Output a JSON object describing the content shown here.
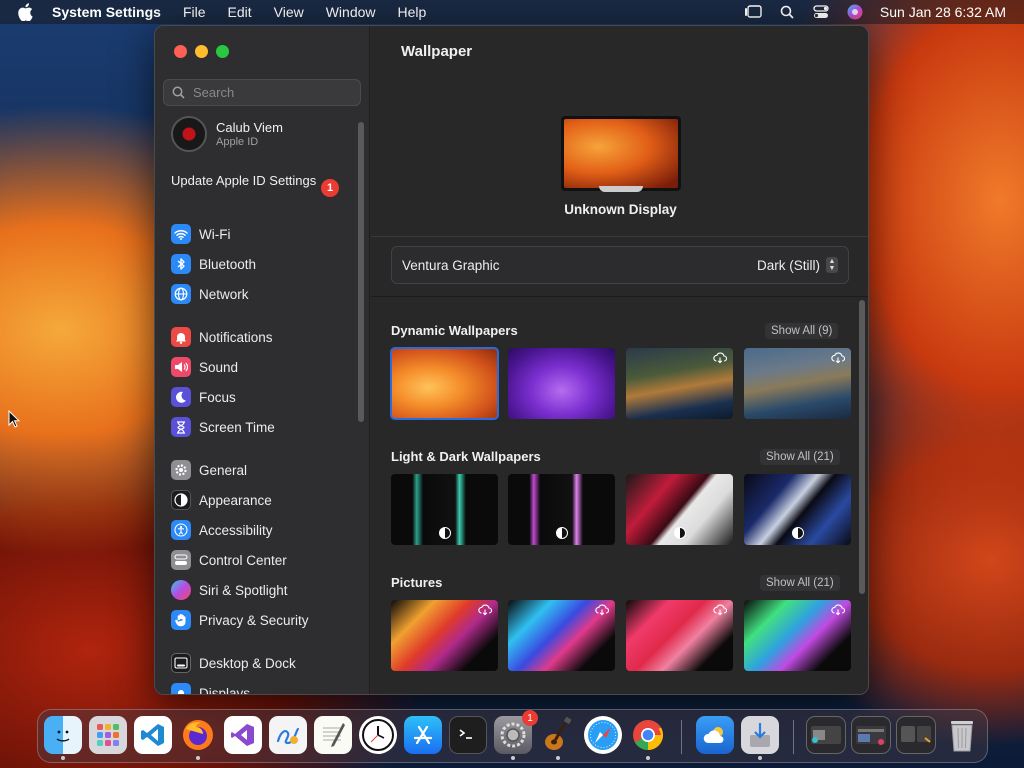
{
  "menubar": {
    "app_name": "System Settings",
    "menus": [
      "File",
      "Edit",
      "View",
      "Window",
      "Help"
    ],
    "datetime": "Sun Jan 28  6:32 AM"
  },
  "sidebar": {
    "search_placeholder": "Search",
    "profile": {
      "name": "Calub Viem",
      "subtitle": "Apple ID"
    },
    "update": {
      "label": "Update Apple ID Settings",
      "badge": "1"
    },
    "items": [
      {
        "label": "Wi-Fi",
        "icon": "wifi-icon",
        "color": "#2b8af7"
      },
      {
        "label": "Bluetooth",
        "icon": "bluetooth-icon",
        "color": "#2b8af7"
      },
      {
        "label": "Network",
        "icon": "globe-icon",
        "color": "#2b8af7"
      },
      {
        "label": "Notifications",
        "icon": "bell-icon",
        "color": "#ec4a45"
      },
      {
        "label": "Sound",
        "icon": "speaker-icon",
        "color": "#ec4a68"
      },
      {
        "label": "Focus",
        "icon": "moon-icon",
        "color": "#5b51d9"
      },
      {
        "label": "Screen Time",
        "icon": "hourglass-icon",
        "color": "#5b51d9"
      },
      {
        "label": "General",
        "icon": "gear-icon",
        "color": "#8e8e93"
      },
      {
        "label": "Appearance",
        "icon": "appearance-icon",
        "color": "#1c1c1e"
      },
      {
        "label": "Accessibility",
        "icon": "accessibility-icon",
        "color": "#2b8af7"
      },
      {
        "label": "Control Center",
        "icon": "control-center-icon",
        "color": "#8e8e93"
      },
      {
        "label": "Siri & Spotlight",
        "icon": "siri-icon",
        "color": "#c2428a"
      },
      {
        "label": "Privacy & Security",
        "icon": "hand-icon",
        "color": "#2b8af7"
      },
      {
        "label": "Desktop & Dock",
        "icon": "dock-icon",
        "color": "#1c1c1e"
      },
      {
        "label": "Displays",
        "icon": "display-icon",
        "color": "#2b8af7"
      }
    ]
  },
  "main": {
    "title": "Wallpaper",
    "display_name": "Unknown Display",
    "wallpaper_name": "Ventura Graphic",
    "wallpaper_mode": "Dark (Still)",
    "sections": [
      {
        "title": "Dynamic Wallpapers",
        "show_all": "Show All (9)"
      },
      {
        "title": "Light & Dark Wallpapers",
        "show_all": "Show All (21)"
      },
      {
        "title": "Pictures",
        "show_all": "Show All (21)"
      }
    ]
  },
  "dock": {
    "apps": [
      "Finder",
      "Launchpad",
      "Visual Studio Code",
      "Firefox",
      "Visual Studio",
      "Freeform",
      "TextEdit",
      "Clock",
      "App Store",
      "Terminal",
      "System Settings",
      "GarageBand",
      "Safari",
      "Chrome",
      "Weather",
      "Installer",
      "Window Group",
      "Downloads",
      "Trash"
    ],
    "system_settings_badge": "1"
  },
  "colors": {
    "accent": "#2a6be0",
    "badge": "#ec3b33"
  }
}
